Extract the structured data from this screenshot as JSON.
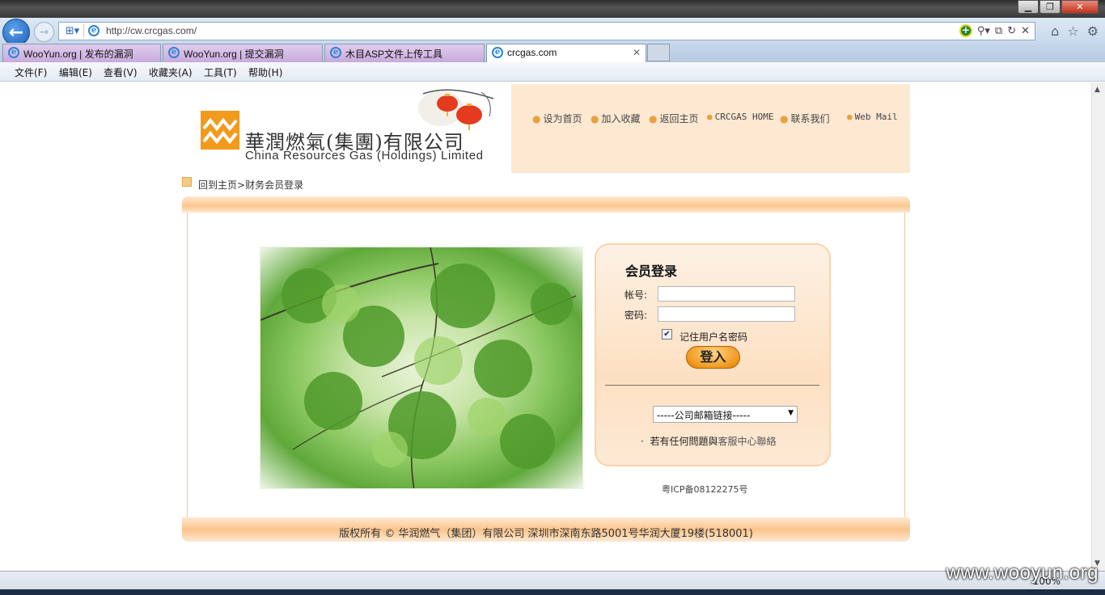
{
  "browser": {
    "address_url": "http://cw.crcgas.com/",
    "tabs": [
      {
        "label": "WooYun.org | 发布的漏洞"
      },
      {
        "label": "WooYun.org | 提交漏洞"
      },
      {
        "label": "木目ASP文件上传工具"
      },
      {
        "label": "crcgas.com"
      }
    ],
    "menu": [
      "文件(F)",
      "编辑(E)",
      "查看(V)",
      "收藏夹(A)",
      "工具(T)",
      "帮助(H)"
    ],
    "zoom": "100%",
    "watermark": "www.wooyun.org"
  },
  "page": {
    "logo_cn": "華潤燃氣(集團)有限公司",
    "logo_en": "China Resources Gas (Holdings) Limited",
    "topnav": [
      "设为首页",
      "加入收藏",
      "返回主页",
      "CRCGAS HOME",
      "联系我们",
      "Web Mail"
    ],
    "breadcrumb_home": "回到主页>",
    "breadcrumb_current": "财务会员登录",
    "login": {
      "title": "会员登录",
      "account_label": "帐号:",
      "password_label": "密码:",
      "account_value": "",
      "password_value": "",
      "remember_label": "记住用户名密码",
      "remember_checked": true,
      "submit_label": "登入",
      "mail_select": "-----公司邮箱链接-----",
      "contact_prefix": "若有任何問題與",
      "contact_link": "客服中心聯絡"
    },
    "icp": "粤ICP备08122275号",
    "copyright": "版权所有 © 华润燃气（集团）有限公司 深圳市深南东路5001号华润大厦19楼(518001)"
  }
}
